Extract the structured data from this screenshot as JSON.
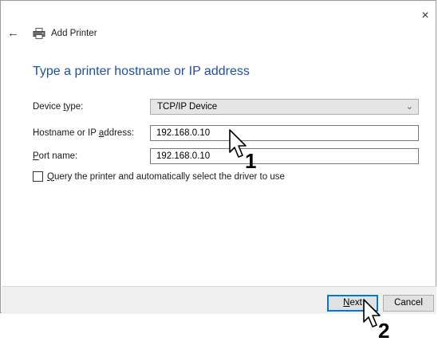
{
  "window": {
    "title": "Add Printer",
    "close_glyph": "×",
    "back_glyph": "←"
  },
  "heading": "Type a printer hostname or IP address",
  "form": {
    "device_type": {
      "label_pre": "Device ",
      "label_accel": "t",
      "label_post": "ype:",
      "value": "TCP/IP Device"
    },
    "hostname": {
      "label_pre": "Hostname or IP ",
      "label_accel": "a",
      "label_post": "ddress:",
      "value": "192.168.0.10"
    },
    "port": {
      "label_pre": "",
      "label_accel": "P",
      "label_post": "ort name:",
      "value": "192.168.0.10"
    },
    "query_checkbox": {
      "label_accel": "Q",
      "label_post": "uery the printer and automatically select the driver to use",
      "checked": false
    }
  },
  "buttons": {
    "next_accel": "N",
    "next_post": "ext",
    "cancel": "Cancel"
  },
  "annotations": {
    "step1": "1",
    "step2": "2"
  },
  "icons": {
    "back": "back-arrow-icon",
    "printer": "printer-icon",
    "close": "close-icon",
    "dropdown": "chevron-down-icon",
    "cursor": "mouse-pointer-icon"
  }
}
